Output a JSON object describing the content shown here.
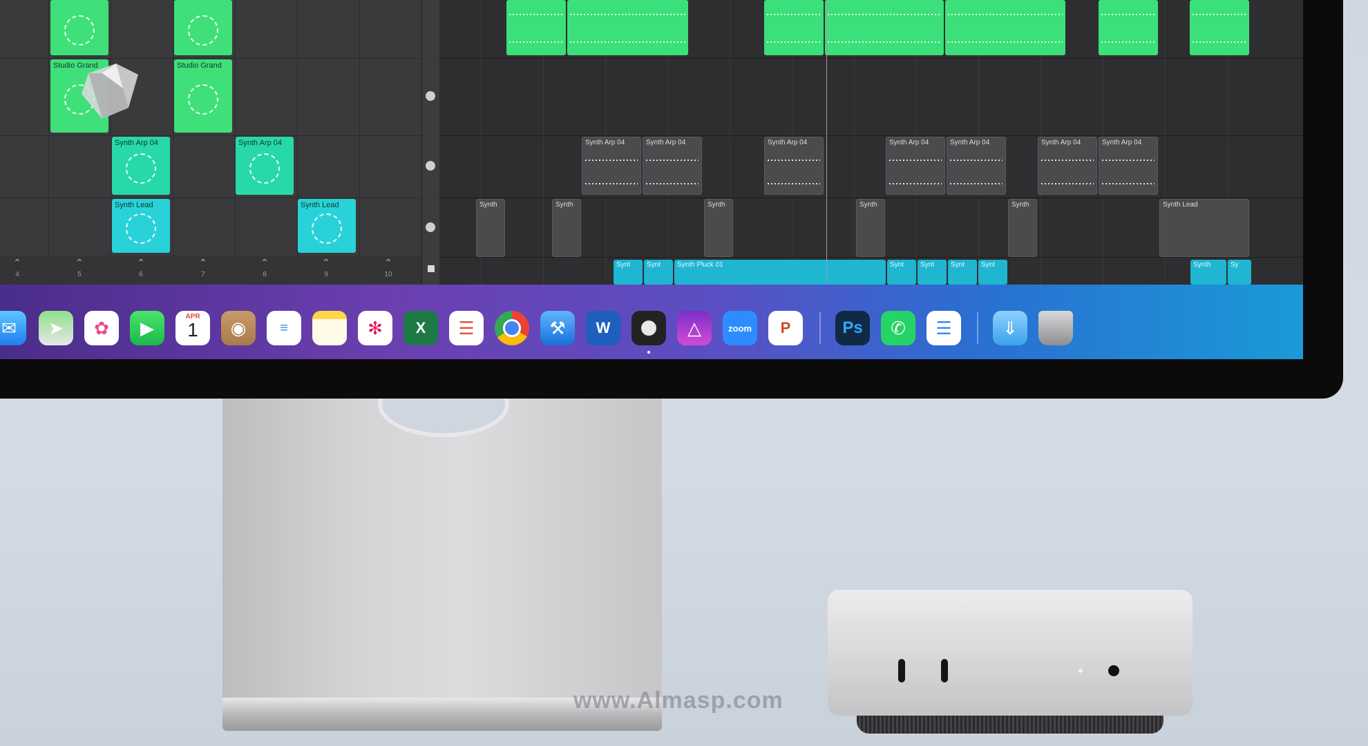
{
  "session": {
    "cells": [
      {
        "label": "Studio Grand"
      },
      {
        "label": "Studio Grand"
      },
      {
        "label": "Synth Arp 04"
      },
      {
        "label": "Synth Arp 04"
      },
      {
        "label": "Synth Lead"
      },
      {
        "label": "Synth Lead"
      }
    ],
    "columns": [
      "4",
      "5",
      "6",
      "7",
      "8",
      "9",
      "10"
    ]
  },
  "arrange": {
    "arp_regions": [
      "Synth Arp 04",
      "Synth Arp 04",
      "Synth Arp 04",
      "Synth Arp 04",
      "Synth Arp 04",
      "Synth Arp 04",
      "Synth Arp 04"
    ],
    "synth_regions": [
      "Synth",
      "Synth",
      "Synth",
      "Synth",
      "Synth",
      "Synth Lead"
    ],
    "pluck_regions": [
      "Synt",
      "Synt",
      "Synth Pluck 01",
      "Synt",
      "Synt",
      "Synt",
      "Synt",
      "Synth",
      "Sy"
    ]
  },
  "dock": {
    "calendar": {
      "month": "APR",
      "day": "1"
    },
    "zoom_label": "zoom",
    "ps_label": "Ps",
    "items": [
      "Mail",
      "Maps",
      "Photos",
      "FaceTime",
      "Calendar",
      "Contacts",
      "Reminders",
      "Notes",
      "Slack",
      "Excel",
      "Speaker Deck",
      "Chrome",
      "Xcode",
      "Word",
      "Logic Pro",
      "Affinity Designer",
      "Zoom",
      "PowerPoint",
      "Photoshop",
      "WhatsApp",
      "Docs",
      "Downloads",
      "Trash"
    ]
  },
  "watermark": "www.Almasp.com",
  "colors": {
    "clip_green": "#3fe07a",
    "clip_cyan": "#29d2d8",
    "region_blue": "#1fb6d1"
  }
}
